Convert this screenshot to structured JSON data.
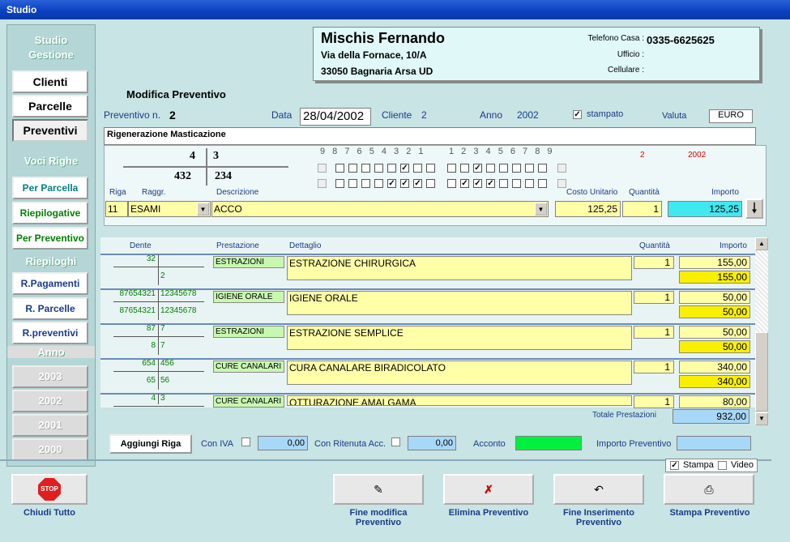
{
  "window": {
    "title": "Studio"
  },
  "sidebar": {
    "header": "Studio\nGestione",
    "nav": [
      "Clienti",
      "Parcelle",
      "Preventivi"
    ],
    "voci_header": "Voci Righe",
    "voci": [
      "Per Parcella",
      "Riepilogative",
      "Per Preventivo"
    ],
    "riepiloghi_header": "Riepiloghi",
    "riepiloghi": [
      "R.Pagamenti",
      "R. Parcelle",
      "R.preventivi"
    ],
    "anno_header": "Anno",
    "anni": [
      "2003",
      "2002",
      "2001",
      "2000"
    ]
  },
  "patient": {
    "name": "Mischis Fernando",
    "address": "Via della Fornace, 10/A",
    "city": "33050  Bagnaria Arsa  UD",
    "tel_casa_label": "Telefono Casa :",
    "tel_casa": "0335-6625625",
    "ufficio_label": "Ufficio :",
    "cellulare_label": "Cellulare :"
  },
  "form": {
    "title": "Modifica Preventivo",
    "preventivo_label": "Preventivo n.",
    "preventivo_n": "2",
    "data_label": "Data",
    "data": "28/04/2002",
    "cliente_label": "Cliente",
    "cliente": "2",
    "anno_label": "Anno",
    "anno": "2002",
    "stampato_label": "stampato",
    "valuta_label": "Valuta",
    "valuta": "EURO",
    "descrizione": "Rigenerazione Masticazione",
    "red_n": "2",
    "red_anno": "2002"
  },
  "odontogram": {
    "upper_left": "4",
    "upper_right": "3",
    "lower_left": "432",
    "lower_right": "234",
    "left_nums": "9  8 7 6 5 4 3 2 1",
    "right_nums": "1 2 3 4 5 6 7 8  9"
  },
  "entry": {
    "riga_label": "Riga",
    "raggr_label": "Raggr.",
    "descr_label": "Descrizione",
    "costo_label": "Costo Unitario",
    "qta_label": "Quantità",
    "importo_label": "Importo",
    "riga": "11",
    "raggr": "ESAMI",
    "descr": "ACCO",
    "costo": "125,25",
    "qta": "1",
    "importo": "125,25"
  },
  "grid": {
    "headers": {
      "dente": "Dente",
      "prestazione": "Prestazione",
      "dettaglio": "Dettaglio",
      "quantita": "Quantità",
      "importo": "Importo"
    },
    "rows": [
      {
        "d1": "32",
        "d2": "",
        "d3": "",
        "d4": "2",
        "prest": "ESTRAZIONI",
        "dett": "ESTRAZIONE CHIRURGICA",
        "qta": "1",
        "imp": "155,00",
        "tot": "155,00"
      },
      {
        "d1": "87654321",
        "d2": "12345678",
        "d3": "87654321",
        "d4": "12345678",
        "prest": "IGIENE ORALE",
        "dett": "IGIENE ORALE",
        "qta": "1",
        "imp": "50,00",
        "tot": "50,00"
      },
      {
        "d1": "87",
        "d2": "7",
        "d3": "8",
        "d4": "7",
        "prest": "ESTRAZIONI",
        "dett": "ESTRAZIONE SEMPLICE",
        "qta": "1",
        "imp": "50,00",
        "tot": "50,00"
      },
      {
        "d1": "654",
        "d2": "456",
        "d3": "65",
        "d4": "56",
        "prest": "CURE CANALARI",
        "dett": "CURA CANALARE BIRADICOLATO",
        "qta": "1",
        "imp": "340,00",
        "tot": "340,00"
      },
      {
        "d1": "4",
        "d2": "3",
        "d3": "",
        "d4": "",
        "prest": "CURE CANALARI",
        "dett": "OTTURAZIONE AMALGAMA",
        "qta": "1",
        "imp": "80,00",
        "tot": ""
      }
    ],
    "totale_label": "Totale Prestazioni",
    "totale": "932,00"
  },
  "footer": {
    "aggiungi": "Aggiungi Riga",
    "iva_label": "Con IVA",
    "iva_val": "0,00",
    "rit_label": "Con Ritenuta Acc.",
    "rit_val": "0,00",
    "acconto_label": "Acconto",
    "importo_prev_label": "Importo Preventivo"
  },
  "actions": {
    "chiudi": "Chiudi Tutto",
    "stop": "STOP",
    "fine_mod": "Fine modifica\nPreventivo",
    "elimina": "Elimina Preventivo",
    "fine_ins": "Fine Inserimento\nPreventivo",
    "stampa": "Stampa Preventivo",
    "stampa_chk": "Stampa",
    "video_chk": "Video"
  }
}
